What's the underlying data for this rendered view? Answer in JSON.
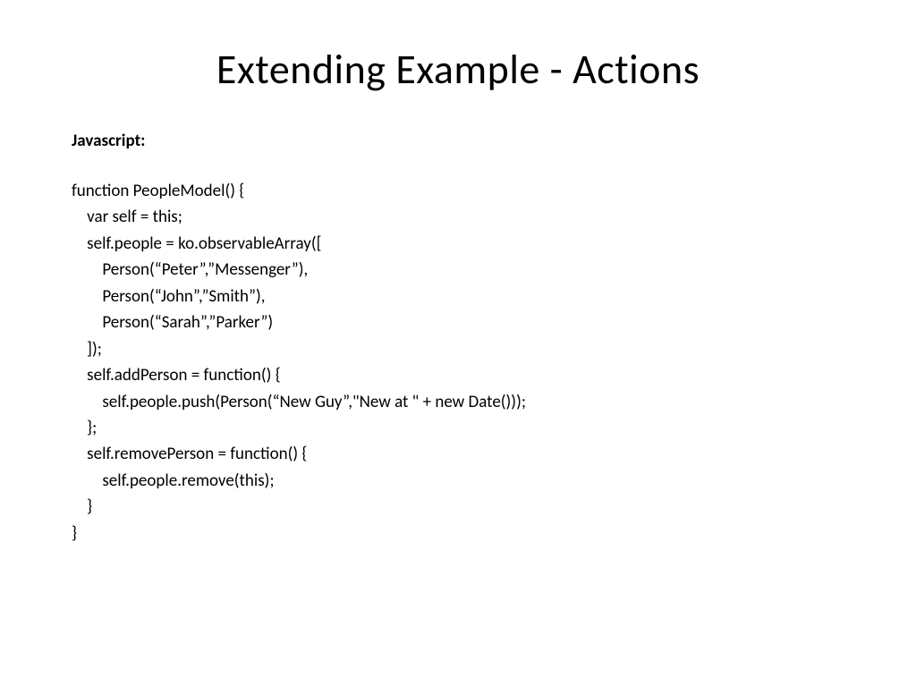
{
  "slide": {
    "title": "Extending Example - Actions",
    "label": "Javascript:",
    "code": "function PeopleModel() {\n    var self = this;\n    self.people = ko.observableArray([\n        Person(“Peter”,”Messenger”),\n        Person(“John”,”Smith”),\n        Person(“Sarah”,”Parker”)\n    ]);\n    self.addPerson = function() {\n        self.people.push(Person(“New Guy”,\"New at \" + new Date()));\n    };\n    self.removePerson = function() {\n        self.people.remove(this);\n    }\n}"
  }
}
